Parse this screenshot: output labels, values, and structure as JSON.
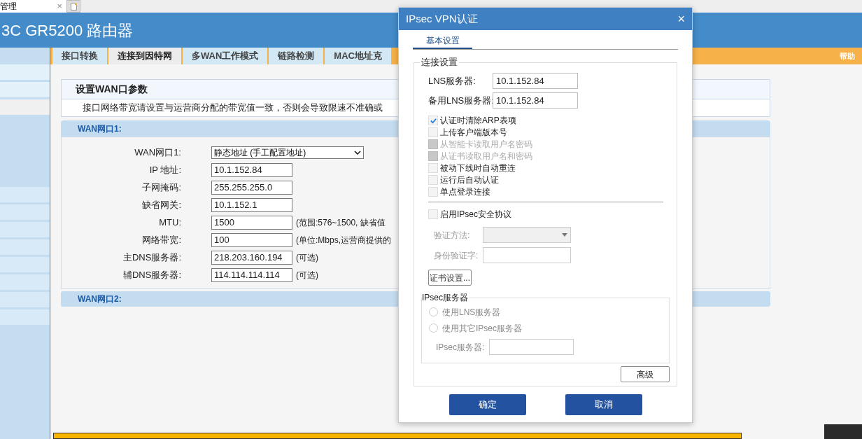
{
  "browser_tab": {
    "title": "管理",
    "close": "×"
  },
  "header": {
    "title": "3C GR5200 路由器"
  },
  "top_bar": {
    "help": "帮助"
  },
  "tabs": [
    {
      "label": "接口转换",
      "selected": false
    },
    {
      "label": "连接到因特网",
      "selected": true
    },
    {
      "label": "多WAN工作模式",
      "selected": false
    },
    {
      "label": "链路检测",
      "selected": false
    },
    {
      "label": "MAC地址克",
      "selected": false
    }
  ],
  "panel": {
    "title": "设置WAN口参数",
    "note": "接口网络带宽请设置与运营商分配的带宽值一致，否则会导致限速不准确或",
    "section_1": "WAN网口1:",
    "section_2": "WAN网口2:",
    "fields": [
      {
        "kind": "select",
        "label": "WAN网口1:",
        "value": "静态地址 (手工配置地址)"
      },
      {
        "kind": "input",
        "label": "IP 地址:",
        "value": "10.1.152.84"
      },
      {
        "kind": "input",
        "label": "子网掩码:",
        "value": "255.255.255.0"
      },
      {
        "kind": "input",
        "label": "缺省网关:",
        "value": "10.1.152.1"
      },
      {
        "kind": "input",
        "label": "MTU:",
        "value": "1500",
        "hint": "(范围:576~1500, 缺省值"
      },
      {
        "kind": "input",
        "label": "网络带宽:",
        "value": "100",
        "hint": "(单位:Mbps,运营商提供的"
      },
      {
        "kind": "input",
        "label": "主DNS服务器:",
        "value": "218.203.160.194",
        "hint": "(可选)"
      },
      {
        "kind": "input",
        "label": "辅DNS服务器:",
        "value": "114.114.114.114",
        "hint": "(可选)"
      }
    ]
  },
  "dialog": {
    "title": "IPsec VPN认证",
    "close": "×",
    "tab": "基本设置",
    "group": "连接设置",
    "servers": [
      {
        "label": "LNS服务器:",
        "value": "10.1.152.84"
      },
      {
        "label": "备用LNS服务器:",
        "value": "10.1.152.84"
      }
    ],
    "options": [
      {
        "label": "认证时清除ARP表项",
        "checked": true,
        "disabled": false
      },
      {
        "label": "上传客户端版本号",
        "checked": false,
        "disabled": false
      },
      {
        "label": "从智能卡读取用户名密码",
        "checked": false,
        "disabled": true
      },
      {
        "label": "从证书读取用户名和密码",
        "checked": false,
        "disabled": true
      },
      {
        "label": "被动下线时自动重连",
        "checked": false,
        "disabled": false
      },
      {
        "label": "运行后自动认证",
        "checked": false,
        "disabled": false
      },
      {
        "label": "单点登录连接",
        "checked": false,
        "disabled": false
      }
    ],
    "ipsec": {
      "label": "启用IPsec安全协议",
      "checked": false
    },
    "auth_method_label": "验证方法:",
    "auth_key_label": "身份验证字:",
    "cert_button": "证书设置...",
    "server_group": "IPsec服务器",
    "radios": [
      {
        "label": "使用LNS服务器",
        "selected": false
      },
      {
        "label": "使用其它IPsec服务器",
        "selected": false
      }
    ],
    "server_label": "IPsec服务器:",
    "advanced": "高级",
    "ok": "确定",
    "cancel": "取消"
  }
}
